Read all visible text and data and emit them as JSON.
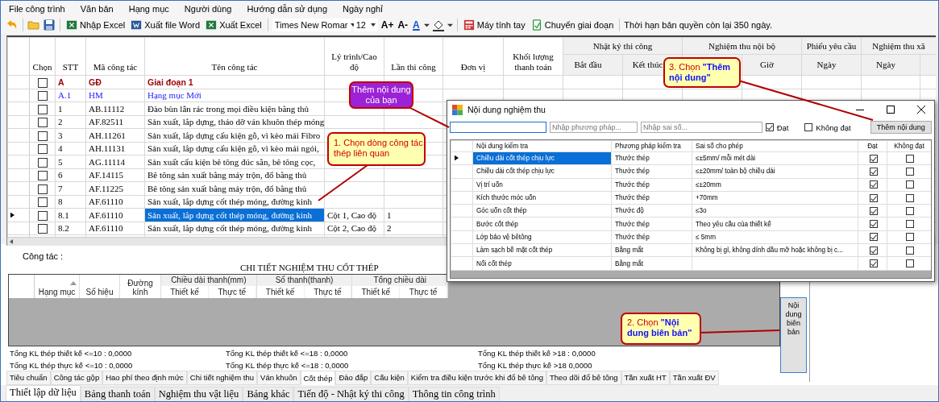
{
  "menu": [
    "File công trình",
    "Văn bản",
    "Hạng mục",
    "Người dùng",
    "Hướng dẫn sử dụng",
    "Ngày nghỉ"
  ],
  "toolbar": {
    "import_excel": "Nhập Excel",
    "export_word": "Xuất file Word",
    "export_excel": "Xuất Excel",
    "font": "Times New Romar",
    "size": "12",
    "grow": "A+",
    "shrink": "A-",
    "text_color_glyph": "A",
    "calculator": "Máy tính tay",
    "change_phase": "Chuyển giai đoạn",
    "license": "Thời hạn bản quyền còn lại 350 ngày."
  },
  "grid": {
    "columns": [
      "Chọn",
      "STT",
      "Mã công tác",
      "Tên công tác",
      "Lý trình/Cao độ",
      "Lần thi công",
      "Đơn vị",
      "Khối lượng thanh toán"
    ],
    "groups": [
      {
        "label": "Nhật ký thi công",
        "columns": [
          "Bắt đầu",
          "Kết thúc"
        ]
      },
      {
        "label": "Nghiệm thu nội bộ",
        "columns": [
          "Giờ"
        ]
      },
      {
        "label": "Phiếu yêu cầu",
        "columns": [
          "Ngày"
        ]
      },
      {
        "label": "Nghiệm thu xã",
        "columns": [
          "Ngày"
        ]
      }
    ],
    "rows": [
      {
        "stt": "A",
        "code": "GĐ",
        "name": "Giai đoạn 1",
        "kind": "phase",
        "checked": false,
        "selected": false
      },
      {
        "stt": "A.1",
        "code": "HM",
        "name": "Hạng mục Mới",
        "kind": "category",
        "checked": false,
        "selected": false
      },
      {
        "stt": "1",
        "code": "AB.11112",
        "name": "Đào bùn lẫn rác trong mọi điều kiện bằng thủ",
        "kind": "task",
        "checked": false,
        "selected": false
      },
      {
        "stt": "2",
        "code": "AF.82511",
        "name": "Sản xuất, lắp dựng, tháo dỡ ván khuôn thép móng",
        "kind": "task",
        "checked": false,
        "selected": false
      },
      {
        "stt": "3",
        "code": "AH.11261",
        "name": "Sản xuất, lắp dựng cấu kiện gỗ, vì kèo mái Fibro",
        "kind": "task",
        "checked": false,
        "selected": false
      },
      {
        "stt": "4",
        "code": "AH.11131",
        "name": "Sản xuất, lắp dựng cấu kiện gỗ, vì kèo mái ngói,",
        "kind": "task",
        "checked": false,
        "selected": false
      },
      {
        "stt": "5",
        "code": "AG.11114",
        "name": "Sản xuất cấu kiện bê tông đúc sẵn, bê tông cọc,",
        "kind": "task",
        "checked": false,
        "selected": false
      },
      {
        "stt": "6",
        "code": "AF.14115",
        "name": "Bê tông sản xuất bằng máy trộn, đổ bằng thủ",
        "kind": "task",
        "checked": false,
        "selected": false
      },
      {
        "stt": "7",
        "code": "AF.11225",
        "name": "Bê tông sản xuất bằng máy trộn, đổ bằng thủ",
        "kind": "task",
        "checked": false,
        "selected": false
      },
      {
        "stt": "8",
        "code": "AF.61110",
        "name": "Sản xuất, lắp dựng cốt thép móng, đường kinh",
        "kind": "task",
        "checked": false,
        "selected": false
      },
      {
        "stt": "8.1",
        "code": "AF.61110",
        "name": "Sản xuất, lắp dựng cốt thép móng, đường kinh",
        "station": "Cột 1, Cao độ",
        "times": "1",
        "kind": "task",
        "checked": false,
        "selected": true
      },
      {
        "stt": "8.2",
        "code": "AF.61110",
        "name": "Sản xuất, lắp dựng cốt thép móng, đường kinh",
        "station": "Cột 2, Cao độ",
        "times": "2",
        "kind": "task",
        "checked": false,
        "selected": false
      }
    ]
  },
  "bottom": {
    "work_label": "Công tác :",
    "title": "CHI TIẾT NGHIỆM THU CỐT THÉP",
    "columns": [
      "Hạng mục",
      "Số hiệu",
      "Đường kính"
    ],
    "groups": [
      {
        "label": "Chiều dài thanh(mm)",
        "columns": [
          "Thiết kế",
          "Thực tế"
        ]
      },
      {
        "label": "Số thanh(thanh)",
        "columns": [
          "Thiết kế",
          "Thực tế"
        ]
      },
      {
        "label": "Tổng chiều dài",
        "columns": [
          "Thiết kế",
          "Thực tế"
        ]
      }
    ],
    "totals": [
      "Tổng KL thép thiết kế <=10 : 0,0000",
      "Tổng KL thép thiết kế <=18 : 0,0000",
      "Tổng KL thép thiết kế >18 : 0,0000",
      "Tổng KL thép thực kế <=10 : 0,0000",
      "Tổng KL thép thực kế <=18 : 0,0000",
      "Tổng KL thép thực kế >18 0,0000"
    ],
    "report_button": "Nội dung biên bản",
    "sub_tabs": [
      {
        "label": "Tiêu chuẩn",
        "selected": false
      },
      {
        "label": "Công tác gộp",
        "selected": false
      },
      {
        "label": "Hao phí theo định mức",
        "selected": false
      },
      {
        "label": "Chi tiết nghiệm thu",
        "selected": false
      },
      {
        "label": "Ván khuôn",
        "selected": false
      },
      {
        "label": "Cốt thép",
        "selected": true
      },
      {
        "label": "Đào đắp",
        "selected": false
      },
      {
        "label": "Cấu kiện",
        "selected": false
      },
      {
        "label": "Kiểm tra điều kiện trước khi đổ bê tông",
        "selected": false
      },
      {
        "label": "Theo dõi đổ bê tông",
        "selected": false
      },
      {
        "label": "Tần xuất HT",
        "selected": false
      },
      {
        "label": "Tần xuất ĐV",
        "selected": false
      }
    ]
  },
  "main_tabs": [
    {
      "label": "Thiết lập dữ liệu",
      "selected": true
    },
    {
      "label": "Bảng thanh toán",
      "selected": false
    },
    {
      "label": "Nghiệm thu vật liệu",
      "selected": false
    },
    {
      "label": "Bảng khác",
      "selected": false
    },
    {
      "label": "Tiến độ - Nhật ký thi công",
      "selected": false
    },
    {
      "label": "Thông tin công trình",
      "selected": false
    }
  ],
  "dialog": {
    "title": "Nội dung nghiệm thu",
    "method_placeholder": "Nhập phương pháp...",
    "tolerance_placeholder": "Nhập sai số...",
    "pass": {
      "label": "Đạt",
      "checked": true
    },
    "fail": {
      "label": "Không đạt",
      "checked": false
    },
    "add_button": "Thêm nội dung",
    "columns": [
      "Nội dung kiểm tra",
      "Phương pháp kiểm tra",
      "Sai số cho phép",
      "Đạt",
      "Không đạt"
    ],
    "rows": [
      {
        "content": "Chiều dài cốt thép chịu lực",
        "method": "Thước thép",
        "tolerance": "≤±5mm/ mỗi mét dài",
        "pass": true,
        "fail": false,
        "selected": true
      },
      {
        "content": "Chiều dài cốt thép chịu lực",
        "method": "Thước thép",
        "tolerance": "≤±20mm/ toàn bộ chiều dài",
        "pass": true,
        "fail": false,
        "selected": false
      },
      {
        "content": "Vị trí uốn",
        "method": "Thước thép",
        "tolerance": "≤±20mm",
        "pass": true,
        "fail": false,
        "selected": false
      },
      {
        "content": "Kích thước móc uốn",
        "method": "Thước thép",
        "tolerance": "+70mm",
        "pass": true,
        "fail": false,
        "selected": false
      },
      {
        "content": "Góc uốn cốt thép",
        "method": "Thước độ",
        "tolerance": "≤3o",
        "pass": true,
        "fail": false,
        "selected": false
      },
      {
        "content": "Bước cốt thép",
        "method": "Thước thép",
        "tolerance": "Theo yêu cầu của thiết kế",
        "pass": true,
        "fail": false,
        "selected": false
      },
      {
        "content": "Lớp bảo vệ bêtông",
        "method": "Thước thép",
        "tolerance": "≤ 5mm",
        "pass": true,
        "fail": false,
        "selected": false
      },
      {
        "content": "Làm sạch bề mặt cốt thép",
        "method": "Bằng mắt",
        "tolerance": "Không bị gỉ, không dính dầu mỡ hoặc không bị c...",
        "pass": true,
        "fail": false,
        "selected": false
      },
      {
        "content": "Nối cốt thép",
        "method": "Bằng mắt",
        "pass": true,
        "fail": false,
        "selected": false
      }
    ]
  },
  "callouts": [
    {
      "kind": "purple",
      "text": "Thêm nội dung của bạn"
    },
    {
      "kind": "yellow",
      "text": "1. Chọn dòng công tác thép liên quan"
    },
    {
      "kind": "yellow",
      "prefix": "3. Chọn ",
      "emphasis": "\"Thêm nội dung\""
    },
    {
      "kind": "yellow",
      "prefix": "2. Chọn ",
      "emphasis": "\"Nội dung biên bản\""
    }
  ]
}
